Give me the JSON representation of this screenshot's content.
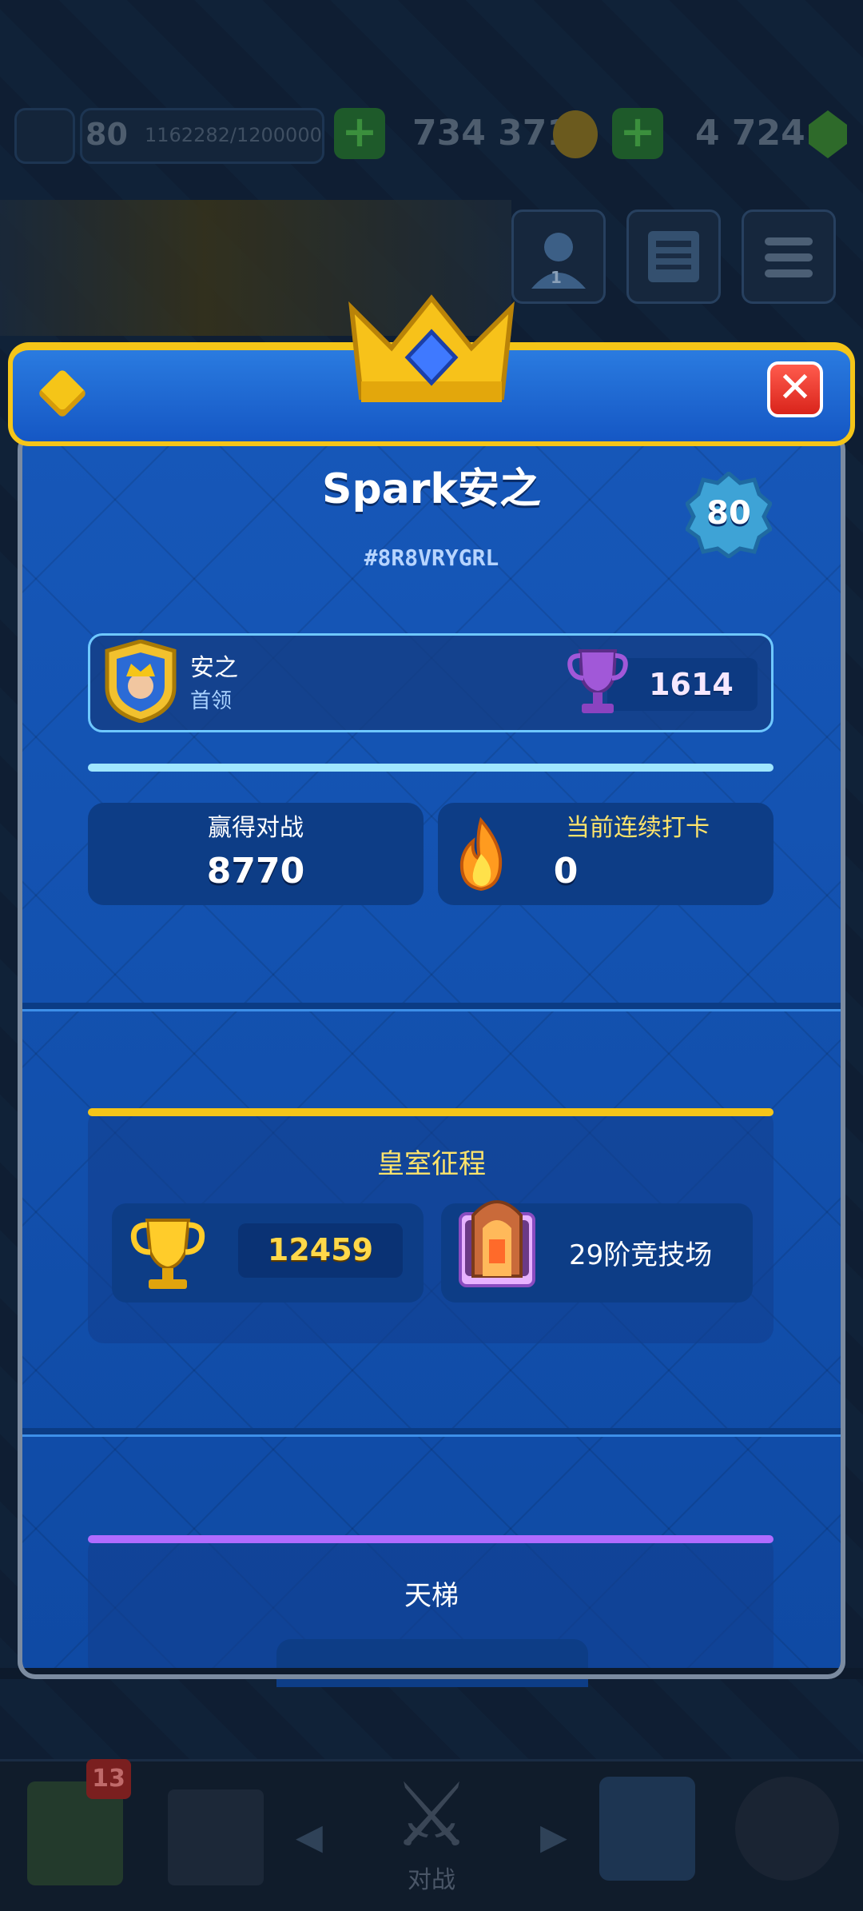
{
  "top_bar": {
    "level": "80",
    "xp": "1162282/1200000",
    "gold": "734 371",
    "gems": "4 724",
    "friends_count": "1"
  },
  "header": {
    "close_symbol": "✕"
  },
  "profile": {
    "name": "Spark安之",
    "tag": "#8R8VRYGRL",
    "level": "80",
    "clan_name": "安之",
    "clan_role": "首领",
    "trophies": "1614"
  },
  "stats": {
    "wins_label": "赢得对战",
    "wins_value": "8770",
    "streak_label": "当前连续打卡",
    "streak_value": "0"
  },
  "royal_road": {
    "title": "皇室征程",
    "trophies": "12459",
    "arena": "29阶竞技场"
  },
  "ladder": {
    "title": "天梯"
  },
  "bottom_nav": {
    "badge": "13",
    "battle_label": "对战"
  },
  "colors": {
    "accent_gold": "#f5c518",
    "panel_blue": "#1457b4",
    "ladder_purple": "#b06cff",
    "cyan_line": "#9fe6ff"
  }
}
